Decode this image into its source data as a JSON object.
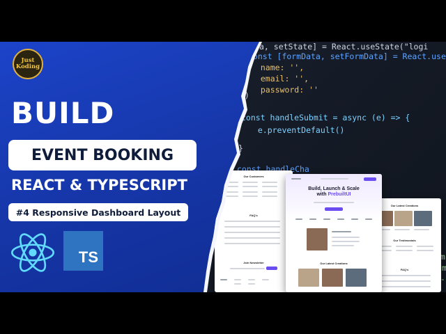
{
  "branding": {
    "logo_line1": "Just",
    "logo_line2": "Koding"
  },
  "headline": {
    "build": "BUILD",
    "project": "EVENT BOOKING",
    "stack": "REACT & TYPESCRIPT",
    "episode": "#4 Responsive Dashboard Layout"
  },
  "tech_icons": {
    "react": "react-icon",
    "typescript_label": "TS"
  },
  "code_snippet": {
    "lines": [
      "a, setState] = React.useState(\"logi",
      "const [formData, setFormData] = React.useState",
      "  name: '',",
      "  email: '',",
      "  password: ''",
      "})",
      "const handleSubmit = async (e) => {",
      "  e.preventDefault()",
      "}",
      "const handleCha",
      "\"sm",
      "l m",
      "nt-"
    ]
  },
  "mockup": {
    "left_heading": "Our Customers",
    "left_faq": "FAQ's",
    "left_newsletter": "Join Newsletter",
    "center_hero_line1": "Build, Launch & Scale",
    "center_hero_line2": "with",
    "center_hero_accent": "PrebuiltUI",
    "center_section": "Our Latest Creations",
    "right_heading": "Our Latest Creations",
    "right_testimonials": "Our Testimonials",
    "right_faq": "FAQ's"
  },
  "colors": {
    "left_panel": "#1c44c9",
    "code_bg": "#1b2230",
    "accent_purple": "#6b4cf0",
    "ts_blue": "#2f74c0",
    "react_cyan": "#61dafb"
  }
}
